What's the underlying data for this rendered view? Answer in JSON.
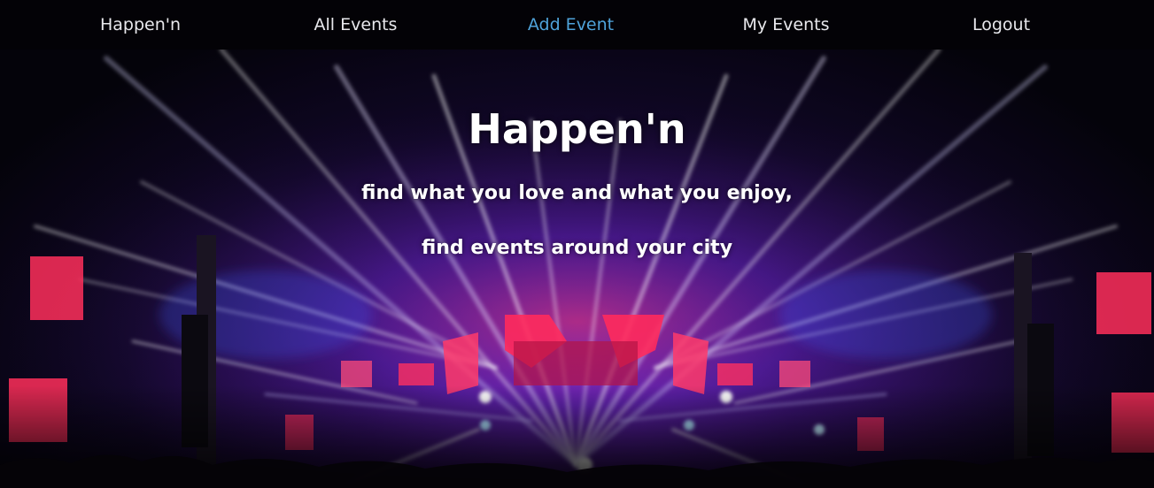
{
  "nav": {
    "items": [
      {
        "label": "Happen'n",
        "active": false
      },
      {
        "label": "All Events",
        "active": false
      },
      {
        "label": "Add Event",
        "active": true
      },
      {
        "label": "My Events",
        "active": false
      },
      {
        "label": "Logout",
        "active": false
      }
    ],
    "colors": {
      "background": "#030206",
      "text": "#e8e8ec",
      "active": "#4fa3da"
    }
  },
  "hero": {
    "title": "Happen'n",
    "tagline_1": "find what you love and what you enjoy,",
    "tagline_2": "find events around your city",
    "background": "concert stage with laser light beams"
  }
}
